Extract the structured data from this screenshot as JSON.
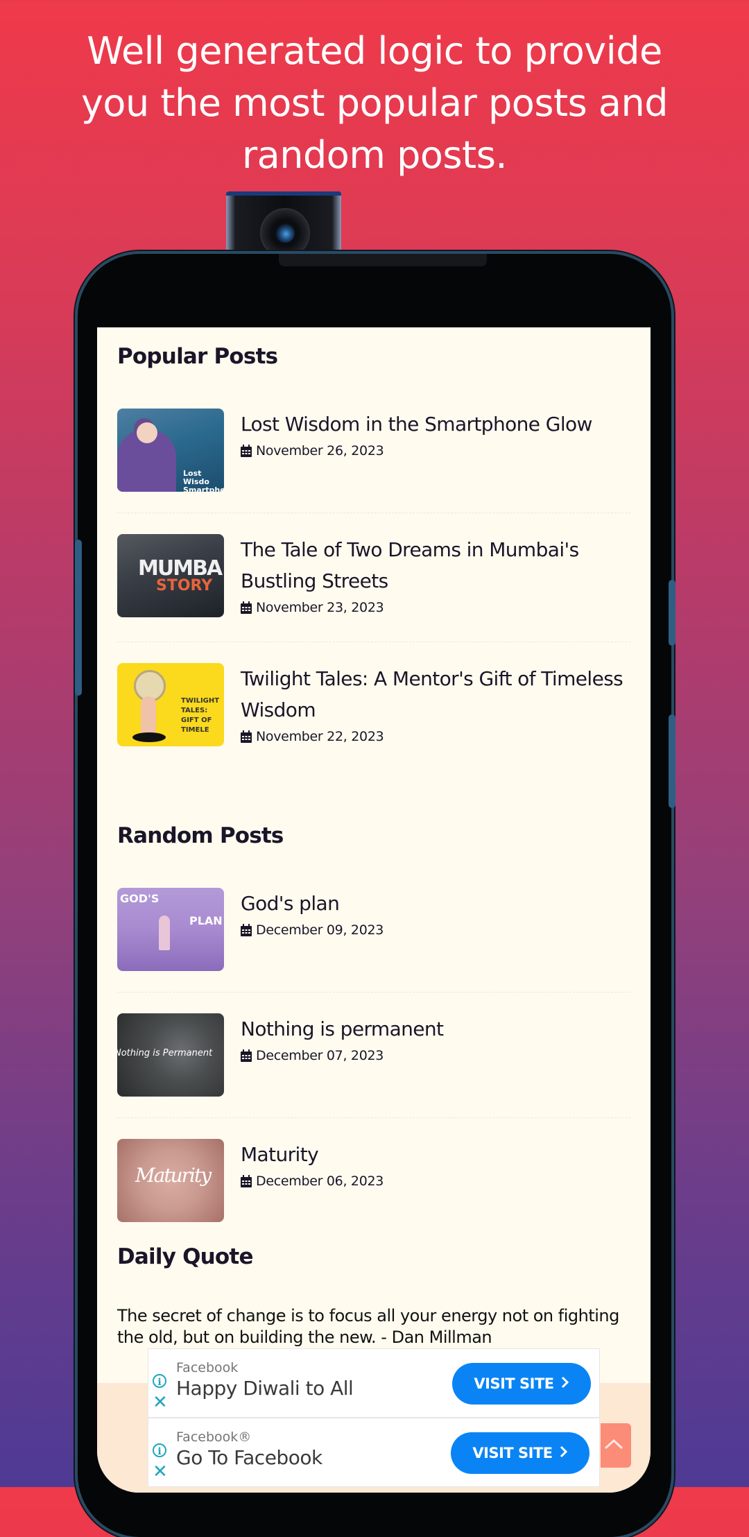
{
  "headline": {
    "lines": [
      "Well generated logic to provide",
      "you the most popular posts and",
      "random posts."
    ]
  },
  "popular_posts": {
    "title": "Popular Posts",
    "items": [
      {
        "title": "Lost Wisdom in the Smartphone Glow",
        "date": "November 26, 2023",
        "thumb_text": "Lost Wisdo Smartpho",
        "thumb_colors": [
          "#2b6a8e",
          "#1c4d6e"
        ]
      },
      {
        "title": "The Tale of Two Dreams in Mumbai's Bustling Streets",
        "date": "November 23, 2023",
        "thumb_text": "MUMBAI STORY",
        "thumb_colors": [
          "#3a3f47",
          "#1e2228"
        ]
      },
      {
        "title": "Twilight Tales: A Mentor's Gift of Timeless Wisdom",
        "date": "November 22, 2023",
        "thumb_text": "TWILIGHT TALES: GIFT OF TIMELESS",
        "thumb_colors": [
          "#fbd91c",
          "#f5cf14"
        ]
      }
    ]
  },
  "random_posts": {
    "title": "Random Posts",
    "items": [
      {
        "title": "God's plan",
        "date": "December 09, 2023",
        "thumb_text": "GOD'S PLAN",
        "thumb_colors": [
          "#a88ad0",
          "#8a6cbc"
        ]
      },
      {
        "title": "Nothing is permanent",
        "date": "December 07, 2023",
        "thumb_text": "Nothing is Permanent",
        "thumb_colors": [
          "#4a4d4e",
          "#2a2c2d"
        ]
      },
      {
        "title": "Maturity",
        "date": "December 06, 2023",
        "thumb_text": "Maturity",
        "thumb_colors": [
          "#c99a90",
          "#a77068"
        ]
      }
    ]
  },
  "daily_quote": {
    "title": "Daily Quote",
    "text": "The secret of change is to focus all your energy not on fighting the old, but on building the new. - Dan Millman"
  },
  "ads": [
    {
      "source": "Facebook",
      "title": "Happy Diwali to All",
      "button": "VISIT SITE"
    },
    {
      "source": "Facebook®",
      "title": "Go To Facebook",
      "button": "VISIT SITE"
    }
  ],
  "icons": {
    "date": "calendar-icon",
    "ad_info": "info-icon",
    "ad_close": "close-icon",
    "ad_button": "chevron-right-icon",
    "scroll_top": "chevron-up-icon"
  },
  "colors": {
    "background_top": "#ef3a4a",
    "background_bottom": "#4e3a94",
    "screen_bg": "#fffbef",
    "text_dark": "#1a1528",
    "ad_button": "#0a84f5",
    "ad_icon": "#1ea5c0",
    "scroll_top": "#fb8c78"
  },
  "ui": {
    "info_glyph": "i",
    "close_glyph": "✕"
  }
}
